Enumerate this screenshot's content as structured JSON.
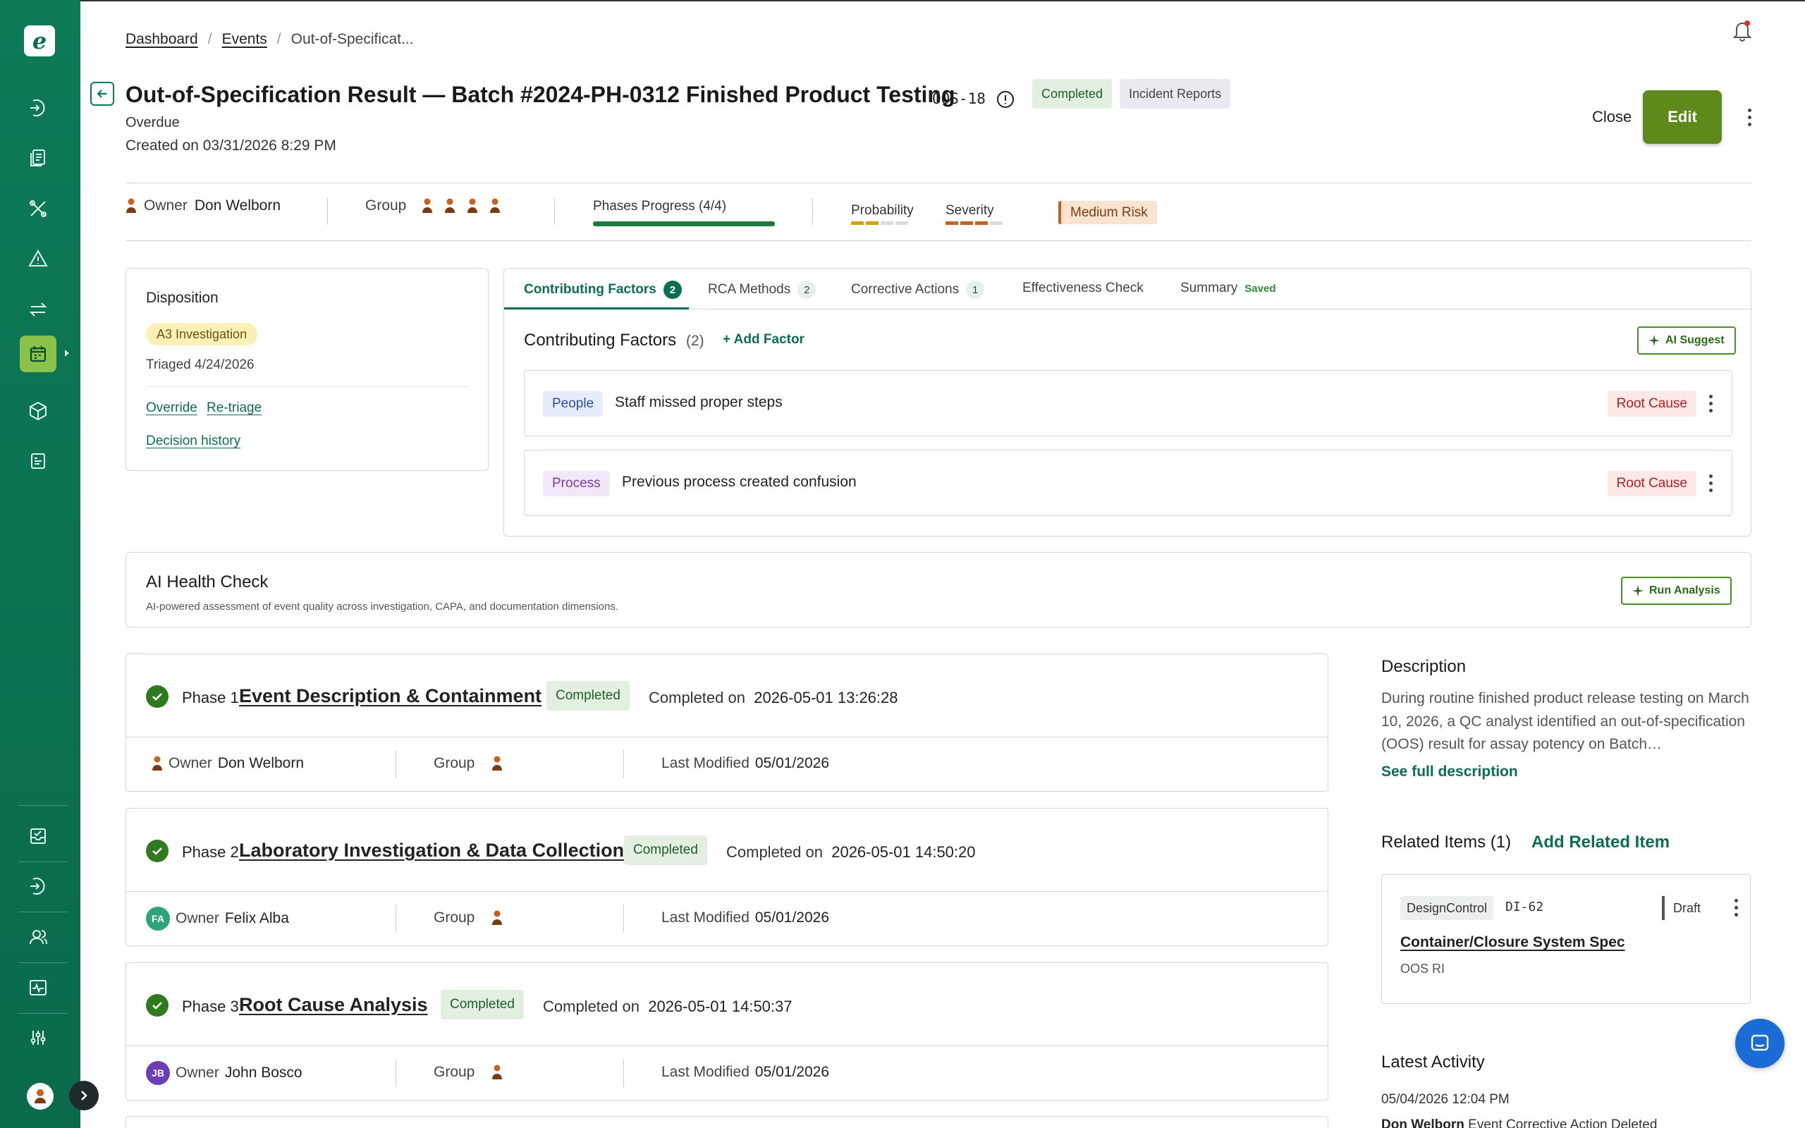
{
  "breadcrumb": {
    "dashboard": "Dashboard",
    "events": "Events",
    "current": "Out-of-Specificat..."
  },
  "header": {
    "title": "Out-of-Specification Result — Batch #2024-PH-0312 Finished Product Testing",
    "code": "OOS-18",
    "status_badge": "Completed",
    "type_badge": "Incident Reports",
    "overdue": "Overdue",
    "created": "Created on 03/31/2026 8:29 PM",
    "close_label": "Close",
    "edit_label": "Edit"
  },
  "meta": {
    "owner_label": "Owner",
    "owner_name": "Don Welborn",
    "group_label": "Group",
    "phases_progress": "Phases Progress (4/4)",
    "phases_done": 4,
    "phases_total": 4,
    "probability_label": "Probability",
    "probability_level": 2,
    "severity_label": "Severity",
    "severity_level": 3,
    "risk_badge": "Medium Risk",
    "colors": {
      "brand": "#0b6e4f",
      "progress": "#1f7a3c",
      "probability": "#d4a20f",
      "severity": "#c4621e"
    }
  },
  "disposition": {
    "title": "Disposition",
    "tag": "A3 Investigation",
    "triaged": "Triaged 4/24/2026",
    "override": "Override",
    "retriage": "Re-triage",
    "history": "Decision history"
  },
  "tabs": [
    {
      "label": "Contributing Factors",
      "count": "2"
    },
    {
      "label": "RCA Methods",
      "count": "2"
    },
    {
      "label": "Corrective Actions",
      "count": "1"
    },
    {
      "label": "Effectiveness Check"
    },
    {
      "label": "Summary",
      "note": "Saved"
    }
  ],
  "factors": {
    "title": "Contributing Factors",
    "count": "(2)",
    "add_label": "+ Add Factor",
    "ai_suggest": "AI Suggest",
    "items": [
      {
        "category": "People",
        "text": "Staff missed proper steps",
        "tag": "Root Cause"
      },
      {
        "category": "Process",
        "text": "Previous process created confusion",
        "tag": "Root Cause"
      }
    ]
  },
  "health": {
    "title": "AI Health Check",
    "subtitle": "AI-powered assessment of event quality across investigation, CAPA, and documentation dimensions.",
    "run_label": "Run Analysis"
  },
  "phases": [
    {
      "num": "Phase 1",
      "name": "Event Description & Containment",
      "status": "Completed",
      "completed_label": "Completed on",
      "completed_at": "2026-05-01 13:26:28",
      "owner_label": "Owner",
      "owner": "Don Welborn",
      "group_label": "Group",
      "modified_label": "Last Modified",
      "modified": "05/01/2026"
    },
    {
      "num": "Phase 2",
      "name": "Laboratory Investigation & Data Collection",
      "status": "Completed",
      "completed_label": "Completed on",
      "completed_at": "2026-05-01 14:50:20",
      "owner_label": "Owner",
      "owner": "Felix Alba",
      "owner_initials": "FA",
      "group_label": "Group",
      "modified_label": "Last Modified",
      "modified": "05/01/2026"
    },
    {
      "num": "Phase 3",
      "name": "Root Cause Analysis",
      "status": "Completed",
      "completed_label": "Completed on",
      "completed_at": "2026-05-01 14:50:37",
      "owner_label": "Owner",
      "owner": "John Bosco",
      "owner_initials": "JB",
      "group_label": "Group",
      "modified_label": "Last Modified",
      "modified": "05/01/2026"
    }
  ],
  "description": {
    "title": "Description",
    "text": "During routine finished product release testing on March 10, 2026, a QC analyst identified an out-of-specification (OOS) result for assay potency on Batch…",
    "see_full": "See full description"
  },
  "related": {
    "title": "Related Items (1)",
    "add_label": "Add Related Item",
    "item": {
      "type": "DesignControl",
      "id": "DI-62",
      "status": "Draft",
      "name": "Container/Closure System Spec",
      "sub": "OOS RI"
    }
  },
  "activity": {
    "title": "Latest Activity",
    "date": "05/04/2026 12:04 PM",
    "user": "Don Welborn",
    "text": "Event Corrective Action Deleted"
  },
  "icons": {
    "sidebar": [
      "logo-icon",
      "events-icon",
      "documents-icon",
      "tools-icon",
      "warning-icon",
      "transfer-icon",
      "calendar-icon",
      "box-icon",
      "forms-icon",
      "inbox-icon",
      "events-icon-2",
      "users-icon",
      "monitor-icon",
      "settings-icon"
    ]
  }
}
